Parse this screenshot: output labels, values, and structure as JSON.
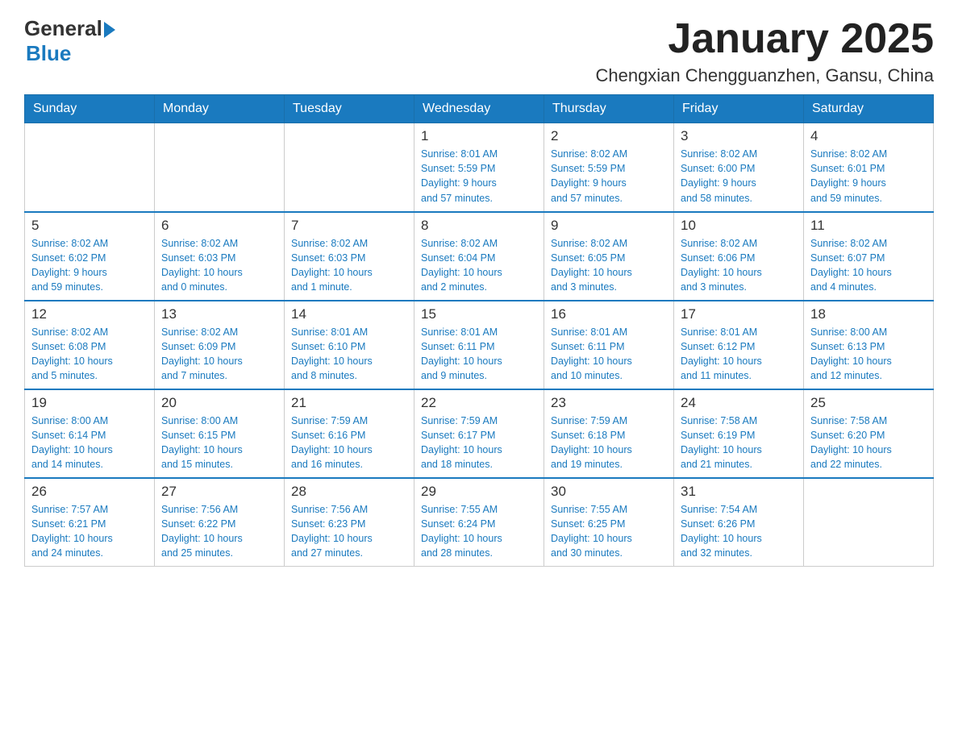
{
  "logo": {
    "general": "General",
    "blue": "Blue"
  },
  "title": "January 2025",
  "location": "Chengxian Chengguanzhen, Gansu, China",
  "days_of_week": [
    "Sunday",
    "Monday",
    "Tuesday",
    "Wednesday",
    "Thursday",
    "Friday",
    "Saturday"
  ],
  "weeks": [
    [
      {
        "day": "",
        "info": ""
      },
      {
        "day": "",
        "info": ""
      },
      {
        "day": "",
        "info": ""
      },
      {
        "day": "1",
        "info": "Sunrise: 8:01 AM\nSunset: 5:59 PM\nDaylight: 9 hours\nand 57 minutes."
      },
      {
        "day": "2",
        "info": "Sunrise: 8:02 AM\nSunset: 5:59 PM\nDaylight: 9 hours\nand 57 minutes."
      },
      {
        "day": "3",
        "info": "Sunrise: 8:02 AM\nSunset: 6:00 PM\nDaylight: 9 hours\nand 58 minutes."
      },
      {
        "day": "4",
        "info": "Sunrise: 8:02 AM\nSunset: 6:01 PM\nDaylight: 9 hours\nand 59 minutes."
      }
    ],
    [
      {
        "day": "5",
        "info": "Sunrise: 8:02 AM\nSunset: 6:02 PM\nDaylight: 9 hours\nand 59 minutes."
      },
      {
        "day": "6",
        "info": "Sunrise: 8:02 AM\nSunset: 6:03 PM\nDaylight: 10 hours\nand 0 minutes."
      },
      {
        "day": "7",
        "info": "Sunrise: 8:02 AM\nSunset: 6:03 PM\nDaylight: 10 hours\nand 1 minute."
      },
      {
        "day": "8",
        "info": "Sunrise: 8:02 AM\nSunset: 6:04 PM\nDaylight: 10 hours\nand 2 minutes."
      },
      {
        "day": "9",
        "info": "Sunrise: 8:02 AM\nSunset: 6:05 PM\nDaylight: 10 hours\nand 3 minutes."
      },
      {
        "day": "10",
        "info": "Sunrise: 8:02 AM\nSunset: 6:06 PM\nDaylight: 10 hours\nand 3 minutes."
      },
      {
        "day": "11",
        "info": "Sunrise: 8:02 AM\nSunset: 6:07 PM\nDaylight: 10 hours\nand 4 minutes."
      }
    ],
    [
      {
        "day": "12",
        "info": "Sunrise: 8:02 AM\nSunset: 6:08 PM\nDaylight: 10 hours\nand 5 minutes."
      },
      {
        "day": "13",
        "info": "Sunrise: 8:02 AM\nSunset: 6:09 PM\nDaylight: 10 hours\nand 7 minutes."
      },
      {
        "day": "14",
        "info": "Sunrise: 8:01 AM\nSunset: 6:10 PM\nDaylight: 10 hours\nand 8 minutes."
      },
      {
        "day": "15",
        "info": "Sunrise: 8:01 AM\nSunset: 6:11 PM\nDaylight: 10 hours\nand 9 minutes."
      },
      {
        "day": "16",
        "info": "Sunrise: 8:01 AM\nSunset: 6:11 PM\nDaylight: 10 hours\nand 10 minutes."
      },
      {
        "day": "17",
        "info": "Sunrise: 8:01 AM\nSunset: 6:12 PM\nDaylight: 10 hours\nand 11 minutes."
      },
      {
        "day": "18",
        "info": "Sunrise: 8:00 AM\nSunset: 6:13 PM\nDaylight: 10 hours\nand 12 minutes."
      }
    ],
    [
      {
        "day": "19",
        "info": "Sunrise: 8:00 AM\nSunset: 6:14 PM\nDaylight: 10 hours\nand 14 minutes."
      },
      {
        "day": "20",
        "info": "Sunrise: 8:00 AM\nSunset: 6:15 PM\nDaylight: 10 hours\nand 15 minutes."
      },
      {
        "day": "21",
        "info": "Sunrise: 7:59 AM\nSunset: 6:16 PM\nDaylight: 10 hours\nand 16 minutes."
      },
      {
        "day": "22",
        "info": "Sunrise: 7:59 AM\nSunset: 6:17 PM\nDaylight: 10 hours\nand 18 minutes."
      },
      {
        "day": "23",
        "info": "Sunrise: 7:59 AM\nSunset: 6:18 PM\nDaylight: 10 hours\nand 19 minutes."
      },
      {
        "day": "24",
        "info": "Sunrise: 7:58 AM\nSunset: 6:19 PM\nDaylight: 10 hours\nand 21 minutes."
      },
      {
        "day": "25",
        "info": "Sunrise: 7:58 AM\nSunset: 6:20 PM\nDaylight: 10 hours\nand 22 minutes."
      }
    ],
    [
      {
        "day": "26",
        "info": "Sunrise: 7:57 AM\nSunset: 6:21 PM\nDaylight: 10 hours\nand 24 minutes."
      },
      {
        "day": "27",
        "info": "Sunrise: 7:56 AM\nSunset: 6:22 PM\nDaylight: 10 hours\nand 25 minutes."
      },
      {
        "day": "28",
        "info": "Sunrise: 7:56 AM\nSunset: 6:23 PM\nDaylight: 10 hours\nand 27 minutes."
      },
      {
        "day": "29",
        "info": "Sunrise: 7:55 AM\nSunset: 6:24 PM\nDaylight: 10 hours\nand 28 minutes."
      },
      {
        "day": "30",
        "info": "Sunrise: 7:55 AM\nSunset: 6:25 PM\nDaylight: 10 hours\nand 30 minutes."
      },
      {
        "day": "31",
        "info": "Sunrise: 7:54 AM\nSunset: 6:26 PM\nDaylight: 10 hours\nand 32 minutes."
      },
      {
        "day": "",
        "info": ""
      }
    ]
  ]
}
